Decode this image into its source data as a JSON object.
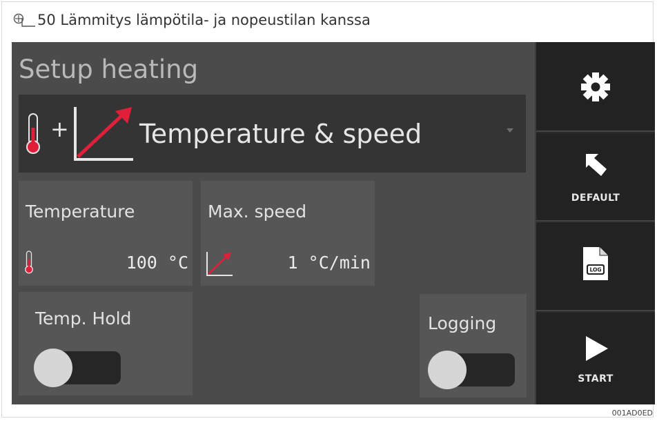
{
  "caption": {
    "figure_label": "50 Lämmitys lämpötila- ja nopeustilan kanssa"
  },
  "screen": {
    "title": "Setup heating",
    "mode_select": {
      "selected": "Temperature & speed",
      "plus": "+"
    },
    "temperature": {
      "label": "Temperature",
      "value": "100 °C"
    },
    "max_speed": {
      "label": "Max. speed",
      "value": "1 °C/min"
    },
    "temp_hold": {
      "label": "Temp. Hold",
      "state": "off"
    },
    "logging": {
      "label": "Logging",
      "state": "off"
    }
  },
  "sidebar": {
    "settings_label": "",
    "default_label": "DEFAULT",
    "log_icon_text": "LOG",
    "start_label": "START"
  },
  "colors": {
    "accent_red": "#e21f3b",
    "background": "#4b4b4b",
    "sidebar": "#222222"
  },
  "footer": {
    "code": "001AD0ED"
  }
}
